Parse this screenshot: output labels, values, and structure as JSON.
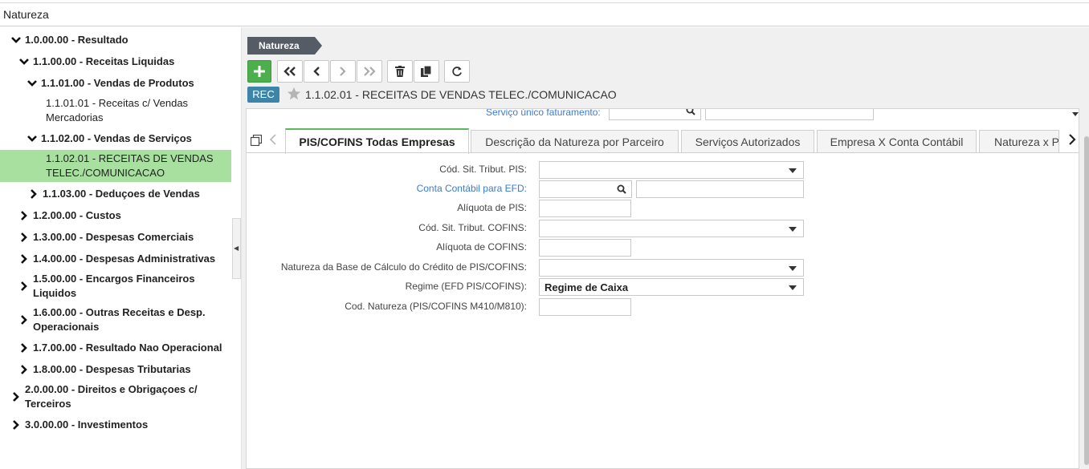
{
  "window": {
    "title": "Natureza"
  },
  "tree": [
    {
      "label": "1.0.00.00 - Resultado",
      "state": "expanded",
      "bold": true
    },
    {
      "label": "1.1.00.00 - Receitas Liquidas",
      "state": "expanded",
      "bold": true
    },
    {
      "label": "1.1.01.00 - Vendas de Produtos",
      "state": "expanded",
      "bold": true
    },
    {
      "label": "1.1.01.01 - Receitas c/ Vendas",
      "label2": "Mercadorias",
      "state": "leaf",
      "bold": false
    },
    {
      "label": "1.1.02.00 - Vendas de Serviços",
      "state": "expanded",
      "bold": true
    },
    {
      "label": "1.1.02.01 - RECEITAS DE VENDAS",
      "label2": "TELEC./COMUNICACAO",
      "state": "leaf",
      "bold": false,
      "selected": true
    },
    {
      "label": "1.1.03.00 - Deduçoes de Vendas",
      "state": "collapsed",
      "bold": true
    },
    {
      "label": "1.2.00.00 - Custos",
      "state": "collapsed",
      "bold": true
    },
    {
      "label": "1.3.00.00 - Despesas Comerciais",
      "state": "collapsed",
      "bold": true
    },
    {
      "label": "1.4.00.00 - Despesas Administrativas",
      "state": "collapsed",
      "bold": true
    },
    {
      "label": "1.5.00.00 - Encargos Financeiros",
      "label2": "Liquidos",
      "state": "collapsed",
      "bold": true
    },
    {
      "label": "1.6.00.00 - Outras Receitas e Desp.",
      "label2": "Operacionais",
      "state": "collapsed",
      "bold": true
    },
    {
      "label": "1.7.00.00 - Resultado Nao Operacional",
      "state": "collapsed",
      "bold": true
    },
    {
      "label": "1.8.00.00 - Despesas Tributarias",
      "state": "collapsed",
      "bold": true
    },
    {
      "label": "2.0.00.00 - Direitos e Obrigaçoes c/",
      "label2": "Terceiros",
      "state": "collapsed",
      "bold": true
    },
    {
      "label": "3.0.00.00 - Investimentos",
      "state": "collapsed",
      "bold": true
    }
  ],
  "breadcrumb": {
    "label": "Natureza"
  },
  "toolbar": {
    "buttons": [
      "add-icon",
      "first-icon",
      "prev-icon",
      "next-icon",
      "last-icon",
      "delete-icon",
      "copy-icon",
      "refresh-icon"
    ],
    "add_color": "#4cae4c"
  },
  "record": {
    "badge": "REC",
    "title": "1.1.02.01 - RECEITAS DE VENDAS TELEC./COMUNICACAO"
  },
  "ghost": {
    "label": "Serviço único faturamento:"
  },
  "tabs": [
    {
      "label": "PIS/COFINS Todas Empresas",
      "active": true
    },
    {
      "label": "Descrição da Natureza por Parceiro"
    },
    {
      "label": "Serviços Autorizados"
    },
    {
      "label": "Empresa X Conta Contábil"
    },
    {
      "label": "Natureza x Projeto"
    }
  ],
  "form": {
    "cst_pis": {
      "label": "Cód. Sit. Tribut. PIS:",
      "value": ""
    },
    "conta_efd": {
      "label": "Conta Contábil para EFD:",
      "value": ""
    },
    "aliq_pis": {
      "label": "Alíquota de PIS:",
      "value": ""
    },
    "cst_cofins": {
      "label": "Cód. Sit. Tribut. COFINS:",
      "value": ""
    },
    "aliq_cofins": {
      "label": "Alíquota de COFINS:",
      "value": ""
    },
    "nat_base": {
      "label": "Natureza da Base de Cálculo do Crédito de PIS/COFINS:",
      "value": ""
    },
    "regime": {
      "label": "Regime (EFD PIS/COFINS):",
      "value": "Regime de Caixa"
    },
    "cod_nat": {
      "label": "Cod. Natureza (PIS/COFINS M410/M810):",
      "value": ""
    }
  }
}
